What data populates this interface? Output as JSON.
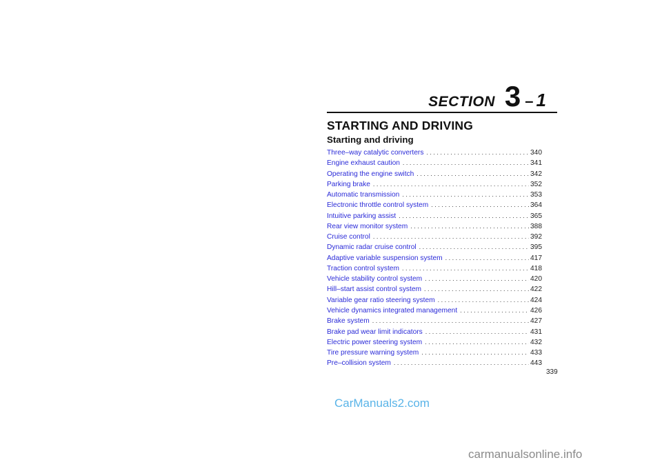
{
  "section": {
    "word": "SECTION",
    "number": "3",
    "separator": "–",
    "sub": "1"
  },
  "title": "STARTING AND DRIVING",
  "subtitle": "Starting and driving",
  "toc": [
    {
      "label": "Three–way catalytic converters",
      "page": "340"
    },
    {
      "label": "Engine exhaust caution",
      "page": "341"
    },
    {
      "label": "Operating the engine switch",
      "page": "342"
    },
    {
      "label": "Parking brake",
      "page": "352"
    },
    {
      "label": "Automatic transmission",
      "page": "353"
    },
    {
      "label": "Electronic throttle control system",
      "page": "364"
    },
    {
      "label": "Intuitive parking assist",
      "page": "365"
    },
    {
      "label": "Rear view monitor system",
      "page": "388"
    },
    {
      "label": "Cruise control",
      "page": "392"
    },
    {
      "label": "Dynamic radar cruise control",
      "page": "395"
    },
    {
      "label": "Adaptive variable suspension system",
      "page": "417"
    },
    {
      "label": "Traction control system",
      "page": "418"
    },
    {
      "label": "Vehicle stability control system",
      "page": "420"
    },
    {
      "label": "Hill–start assist control system",
      "page": "422"
    },
    {
      "label": "Variable gear ratio steering system",
      "page": "424"
    },
    {
      "label": "Vehicle dynamics integrated management",
      "page": "426"
    },
    {
      "label": "Brake system",
      "page": "427"
    },
    {
      "label": "Brake pad wear limit indicators",
      "page": "431"
    },
    {
      "label": "Electric power steering system",
      "page": "432"
    },
    {
      "label": "Tire pressure warning system",
      "page": "433"
    },
    {
      "label": "Pre–collision system",
      "page": "443"
    }
  ],
  "page_number": "339",
  "watermarks": {
    "top": "CarManuals2.com",
    "bottom": "carmanualsonline.info"
  },
  "colors": {
    "link": "#2b2bd8",
    "watermark_top": "#5ab4e8",
    "watermark_bottom": "#8a8a8a"
  }
}
